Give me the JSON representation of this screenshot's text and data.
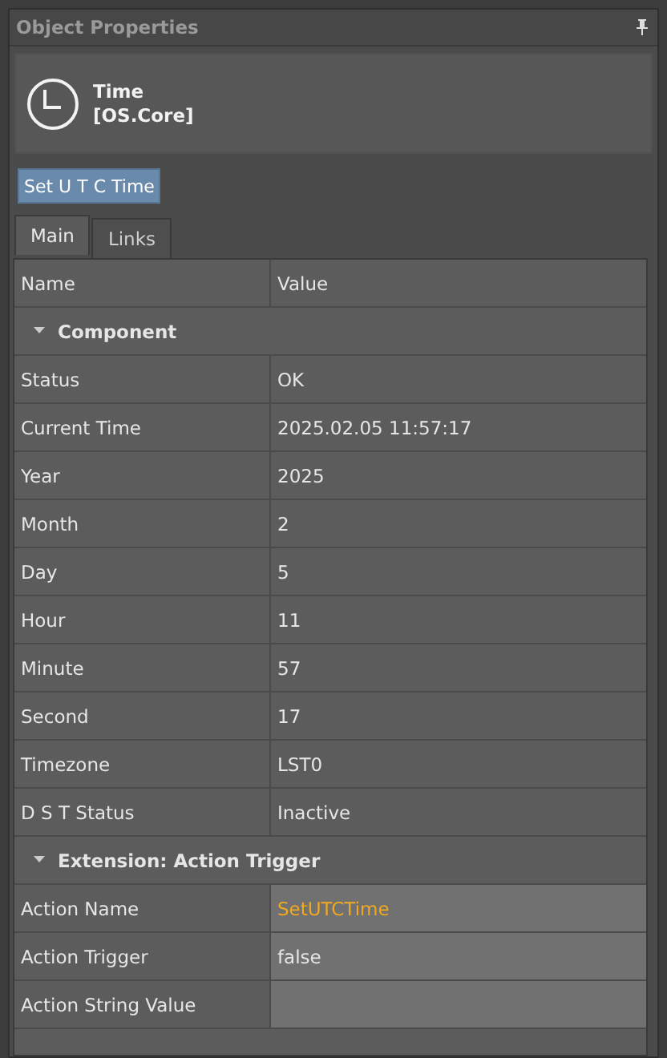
{
  "window": {
    "title": "Object Properties"
  },
  "object": {
    "name": "Time",
    "module": "[OS.Core]"
  },
  "action_button": "Set U T C Time",
  "tabs": [
    {
      "label": "Main",
      "selected": true
    },
    {
      "label": "Links",
      "selected": false
    }
  ],
  "table": {
    "columns": [
      "Name",
      "Value"
    ],
    "groups": [
      {
        "title": "Component",
        "expanded": true,
        "rows": [
          {
            "name": "Status",
            "value": "OK",
            "editable": false
          },
          {
            "name": "Current Time",
            "value": "2025.02.05 11:57:17",
            "editable": false
          },
          {
            "name": "Year",
            "value": "2025",
            "editable": false
          },
          {
            "name": "Month",
            "value": "2",
            "editable": false
          },
          {
            "name": "Day",
            "value": "5",
            "editable": false
          },
          {
            "name": "Hour",
            "value": "11",
            "editable": false
          },
          {
            "name": "Minute",
            "value": "57",
            "editable": false
          },
          {
            "name": "Second",
            "value": "17",
            "editable": false
          },
          {
            "name": "Timezone",
            "value": "LST0",
            "editable": false
          },
          {
            "name": "D S T Status",
            "value": "Inactive",
            "editable": false
          }
        ]
      },
      {
        "title": "Extension: Action Trigger",
        "expanded": true,
        "rows": [
          {
            "name": "Action Name",
            "value": "SetUTCTime",
            "editable": true,
            "modified": true
          },
          {
            "name": "Action Trigger",
            "value": "false",
            "editable": true,
            "modified": false
          },
          {
            "name": "Action String Value",
            "editable": true,
            "modified": false
          }
        ]
      }
    ]
  }
}
